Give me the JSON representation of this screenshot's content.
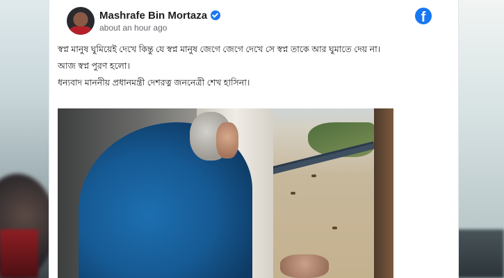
{
  "post": {
    "author": "Mashrafe Bin Mortaza",
    "timestamp": "about an hour ago",
    "paragraphs": [
      "স্বপ্ন মানুষ ঘুমিয়েই দেখে কিন্তু যে স্বপ্ন মানুষ জেগে জেগে দেখে সে স্বপ্ন তাকে আর ঘুমাতে দেয় না।",
      "আজ স্বপ্ন পুরণ হলো।",
      "ধন্যবাদ মাননীয় প্রধানমন্ত্রী দেশরত্ন জননেত্রী শেখ হাসিনা।"
    ]
  },
  "icons": {
    "verified": "verified-badge-icon",
    "platform": "facebook-logo-icon"
  },
  "colors": {
    "facebook_blue": "#1877f2",
    "text_primary": "#1c1e21",
    "text_secondary": "#65676b"
  }
}
